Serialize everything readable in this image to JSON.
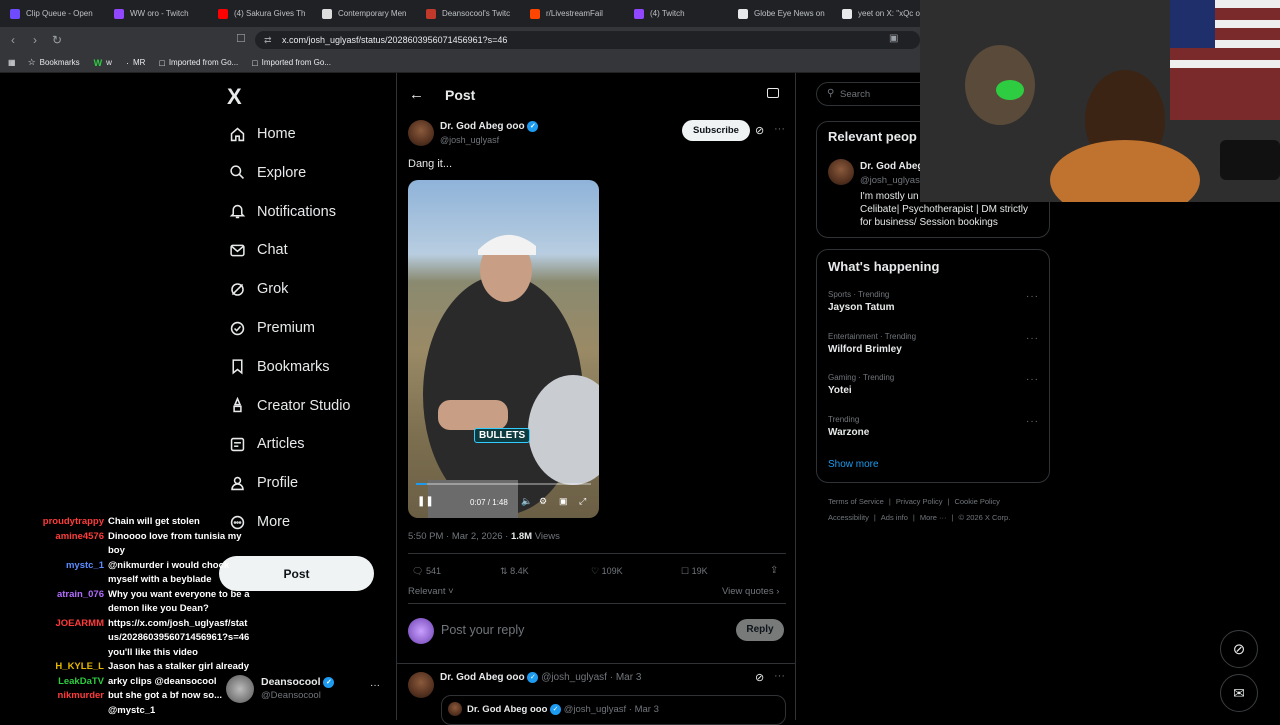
{
  "browser": {
    "tabs": [
      {
        "label": "Clip Queue - Open",
        "color": "#6f4bff"
      },
      {
        "label": "WW oro - Twitch",
        "color": "#9146ff"
      },
      {
        "label": "(4) Sakura Gives Th",
        "color": "#ff0000"
      },
      {
        "label": "Contemporary Men",
        "color": "#dddddd"
      },
      {
        "label": "Deansocool's Twitc",
        "color": "#c0392b"
      },
      {
        "label": "r/LivestreamFail",
        "color": "#ff4500"
      },
      {
        "label": "(4) Twitch",
        "color": "#9146ff"
      },
      {
        "label": "Globe Eye News on",
        "color": "#e7e9ea"
      },
      {
        "label": "yeet on X: \"xQc on",
        "color": "#e7e9ea"
      }
    ],
    "url": "x.com/josh_uglyasf/status/2028603956071456961?s=46",
    "bookmarks": [
      {
        "label": "Bookmarks",
        "icon": "star-icon"
      },
      {
        "label": "w",
        "icon": "w-icon"
      },
      {
        "label": "MR",
        "icon": "mr-icon"
      },
      {
        "label": "Imported from Go...",
        "icon": "folder-icon"
      },
      {
        "label": "Imported from Go...",
        "icon": "folder-icon"
      }
    ]
  },
  "sidebar": {
    "logo": "X",
    "items": [
      {
        "label": "Home",
        "icon": "home-icon"
      },
      {
        "label": "Explore",
        "icon": "search-icon"
      },
      {
        "label": "Notifications",
        "icon": "bell-icon"
      },
      {
        "label": "Chat",
        "icon": "mail-icon"
      },
      {
        "label": "Grok",
        "icon": "grok-icon"
      },
      {
        "label": "Premium",
        "icon": "premium-icon"
      },
      {
        "label": "Bookmarks",
        "icon": "bookmark-icon"
      },
      {
        "label": "Creator Studio",
        "icon": "creator-icon"
      },
      {
        "label": "Articles",
        "icon": "article-icon"
      },
      {
        "label": "Profile",
        "icon": "profile-icon"
      },
      {
        "label": "More",
        "icon": "more-icon"
      }
    ],
    "post_label": "Post",
    "account": {
      "name": "Deansocool",
      "handle": "@Deansocool"
    }
  },
  "main": {
    "header_title": "Post",
    "author": {
      "name": "Dr. God Abeg ooo",
      "handle": "@josh_uglyasf"
    },
    "subscribe_label": "Subscribe",
    "text": "Dang it...",
    "video": {
      "caption": "BULLETS",
      "time": "0:07 / 1:48",
      "progress": 0.065
    },
    "meta": {
      "time": "5:50 PM · Mar 2, 2026 · ",
      "views_count": "1.8M",
      "views_label": " Views"
    },
    "actions": {
      "replies": "541",
      "reposts": "8.4K",
      "likes": "109K",
      "bookmarks": "19K"
    },
    "sort_label": "Relevant",
    "view_quotes": "View quotes",
    "reply_placeholder": "Post your reply",
    "reply_button": "Reply",
    "reply": {
      "name": "Dr. God Abeg ooo",
      "handle": "@josh_uglyasf",
      "date": "· Mar 3"
    },
    "quoted": {
      "name": "Dr. God Abeg ooo",
      "handle": "@josh_uglyasf",
      "date": "· Mar 3"
    }
  },
  "right": {
    "search_placeholder": "Search",
    "relevant_title": "Relevant peop",
    "relevant_person": {
      "name": "Dr. God Abeg",
      "handle": "@josh_uglyas",
      "bio1": "I'm mostly un",
      "bio2": "Celibate| Psychotherapist | DM strictly",
      "bio3": "for business/ Session bookings"
    },
    "happening_title": "What's happening",
    "trends": [
      {
        "category": "Sports · Trending",
        "name": "Jayson Tatum"
      },
      {
        "category": "Entertainment · Trending",
        "name": "Wilford Brimley"
      },
      {
        "category": "Gaming · Trending",
        "name": "Yotei"
      },
      {
        "category": "Trending",
        "name": "Warzone"
      }
    ],
    "show_more": "Show more",
    "footer": [
      "Terms of Service",
      "Privacy Policy",
      "Cookie Policy",
      "Accessibility",
      "Ads info",
      "More ···",
      "© 2026 X Corp."
    ]
  },
  "chat": [
    {
      "user": "proudytrappy",
      "color": "#ff3b3b",
      "msg": "Chain will get stolen"
    },
    {
      "user": "amine4576",
      "color": "#ff3b3b",
      "msg": "Dinoooo love from tunisia my"
    },
    {
      "user": "",
      "color": "#ffffff",
      "msg": "boy"
    },
    {
      "user": "mystc_1",
      "color": "#5b8cff",
      "msg": "@nikmurder i would chock"
    },
    {
      "user": "",
      "color": "#ffffff",
      "msg": "myself with a beyblade"
    },
    {
      "user": "atrain_076",
      "color": "#b36bff",
      "msg": "Why you want everyone to be a"
    },
    {
      "user": "",
      "color": "#ffffff",
      "msg": "demon like you Dean?"
    },
    {
      "user": "JOEARMM",
      "color": "#ff3b3b",
      "msg": "https://x.com/josh_uglyasf/stat"
    },
    {
      "user": "",
      "color": "#ffffff",
      "msg": "us/2028603956071456961?s=46"
    },
    {
      "user": "",
      "color": "#ffffff",
      "msg": "you'll like this video"
    },
    {
      "user": "H_KYLE_L",
      "color": "#e6b800",
      "msg": "Jason has a stalker girl already"
    },
    {
      "user": "LeakDaTV",
      "color": "#2ecc40",
      "msg": "arky clips @deansocool"
    },
    {
      "user": "nikmurder",
      "color": "#ff3b3b",
      "msg": "but she got a bf now so..."
    },
    {
      "user": "",
      "color": "#ffffff",
      "msg": "@mystc_1"
    }
  ],
  "colors": {
    "accent": "#1d9bf0",
    "bg": "#000000",
    "border": "#2f3336"
  }
}
